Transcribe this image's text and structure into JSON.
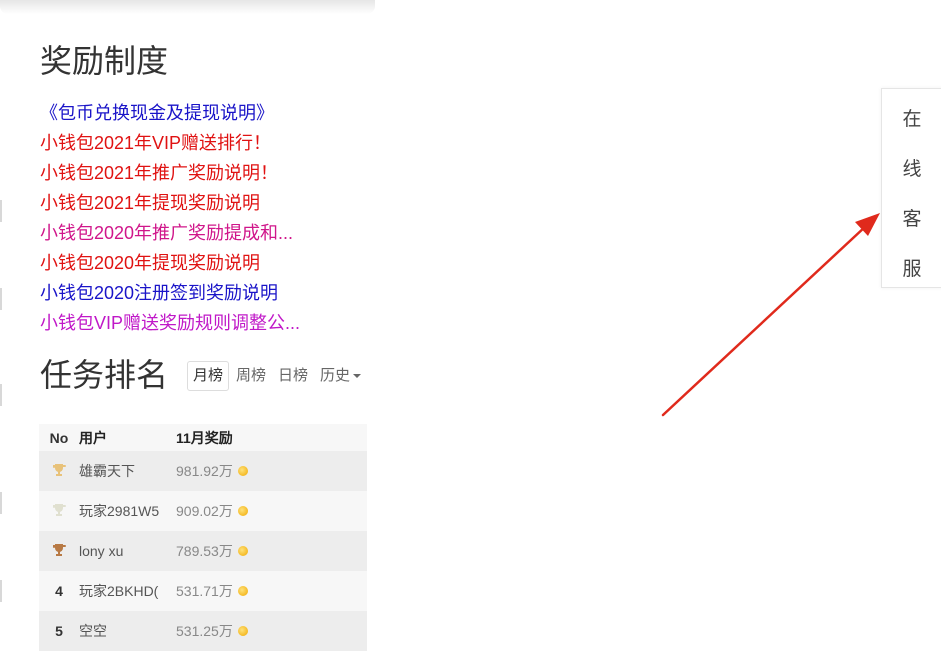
{
  "rewards": {
    "title": "奖励制度",
    "items": [
      {
        "label": "《包币兑换现金及提现说明》",
        "color": "#1a14c8"
      },
      {
        "label": "小钱包2021年VIP赠送排行！",
        "color": "#e01212"
      },
      {
        "label": "小钱包2021年推广奖励说明！",
        "color": "#e01212"
      },
      {
        "label": "小钱包2021年提现奖励说明",
        "color": "#e01212"
      },
      {
        "label": "小钱包2020年推广奖励提成和...",
        "color": "#d0168a"
      },
      {
        "label": "小钱包2020年提现奖励说明",
        "color": "#e01212"
      },
      {
        "label": "小钱包2020注册签到奖励说明",
        "color": "#1a14c8"
      },
      {
        "label": "小钱包VIP赠送奖励规则调整公...",
        "color": "#c018c8"
      }
    ]
  },
  "ranking": {
    "title": "任务排名",
    "tabs": [
      "月榜",
      "周榜",
      "日榜",
      "历史"
    ],
    "active_tab": "月榜",
    "columns": [
      "No",
      "用户",
      "11月奖励"
    ],
    "rows": [
      {
        "rank": "1",
        "user": "雄霸天下",
        "reward": "981.92万",
        "trophy": "gold"
      },
      {
        "rank": "2",
        "user": "玩家2981W5",
        "reward": "909.02万",
        "trophy": "silver"
      },
      {
        "rank": "3",
        "user": "lony xu",
        "reward": "789.53万",
        "trophy": "bronze"
      },
      {
        "rank": "4",
        "user": "玩家2BKHD(",
        "reward": "531.71万",
        "trophy": null
      },
      {
        "rank": "5",
        "user": "空空",
        "reward": "531.25万",
        "trophy": null
      }
    ],
    "trophy_colors": {
      "gold": "#e8c27a",
      "silver": "#e0e0d0",
      "bronze": "#b87a45"
    }
  },
  "customer_service": {
    "chars": [
      "在",
      "线",
      "客",
      "服"
    ]
  },
  "annotation_arrow": {
    "color": "#e02a1c"
  }
}
